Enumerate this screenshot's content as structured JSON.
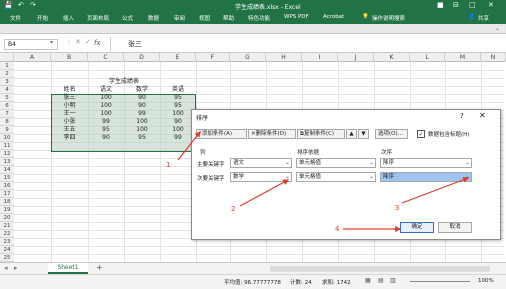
{
  "title": {
    "text": "学生成绩表.xlsx - Excel",
    "controls": [
      "■",
      "⊟",
      "□",
      "✕"
    ]
  },
  "ribbon": {
    "tabs": [
      "文件",
      "开始",
      "插入",
      "页面布局",
      "公式",
      "数据",
      "审阅",
      "视图",
      "帮助",
      "特色功能",
      "WPS PDF",
      "Acrobat",
      "操作说明搜索"
    ],
    "share": "共享"
  },
  "formula_bar": {
    "name_box": "B4",
    "fx": "fx",
    "value": "张三"
  },
  "columns": [
    "A",
    "B",
    "C",
    "D",
    "E",
    "F",
    "G",
    "H",
    "I",
    "J",
    "K",
    "L",
    "M",
    "N"
  ],
  "rows": [
    "1",
    "2",
    "3",
    "4",
    "5",
    "6",
    "7",
    "8",
    "9",
    "10",
    "11",
    "12",
    "13",
    "14",
    "15",
    "16",
    "17",
    "18",
    "19",
    "20",
    "21",
    "22",
    "23",
    "24",
    "25"
  ],
  "sheet": {
    "title": "学生成绩表",
    "headers": [
      "姓名",
      "语文",
      "数学",
      "英语"
    ],
    "data": [
      [
        "张三",
        "100",
        "90",
        "95"
      ],
      [
        "小明",
        "100",
        "90",
        "95"
      ],
      [
        "王一",
        "100",
        "99",
        "100"
      ],
      [
        "小张",
        "99",
        "100",
        "90"
      ],
      [
        "王五",
        "95",
        "100",
        "100"
      ],
      [
        "李四",
        "90",
        "95",
        "99"
      ]
    ]
  },
  "dialog": {
    "title": "排序",
    "help": "?",
    "close": "✕",
    "buttons": {
      "add": "添加条件(A)",
      "delete": "删除条件(D)",
      "copy": "复制条件(C)",
      "up": "▲",
      "down": "▼",
      "options": "选项(O)...",
      "has_header": "数据包含标题(H)"
    },
    "col_header": "列",
    "sort_basis_header": "排序依据",
    "order_header": "次序",
    "rows": [
      {
        "label": "主要关键字",
        "column": "语文",
        "basis": "单元格值",
        "order": "降序"
      },
      {
        "label": "次要关键字",
        "column": "数学",
        "basis": "单元格值",
        "order": "降序"
      }
    ],
    "ok": "确定",
    "cancel": "取消"
  },
  "annotations": [
    "1",
    "2",
    "3",
    "4"
  ],
  "sheet_tabs": {
    "name": "Sheet1",
    "add": "+"
  },
  "status": {
    "avg": "平均值: 96.77777778",
    "count": "计数: 24",
    "sum": "求和: 1742",
    "zoom": "100%"
  }
}
